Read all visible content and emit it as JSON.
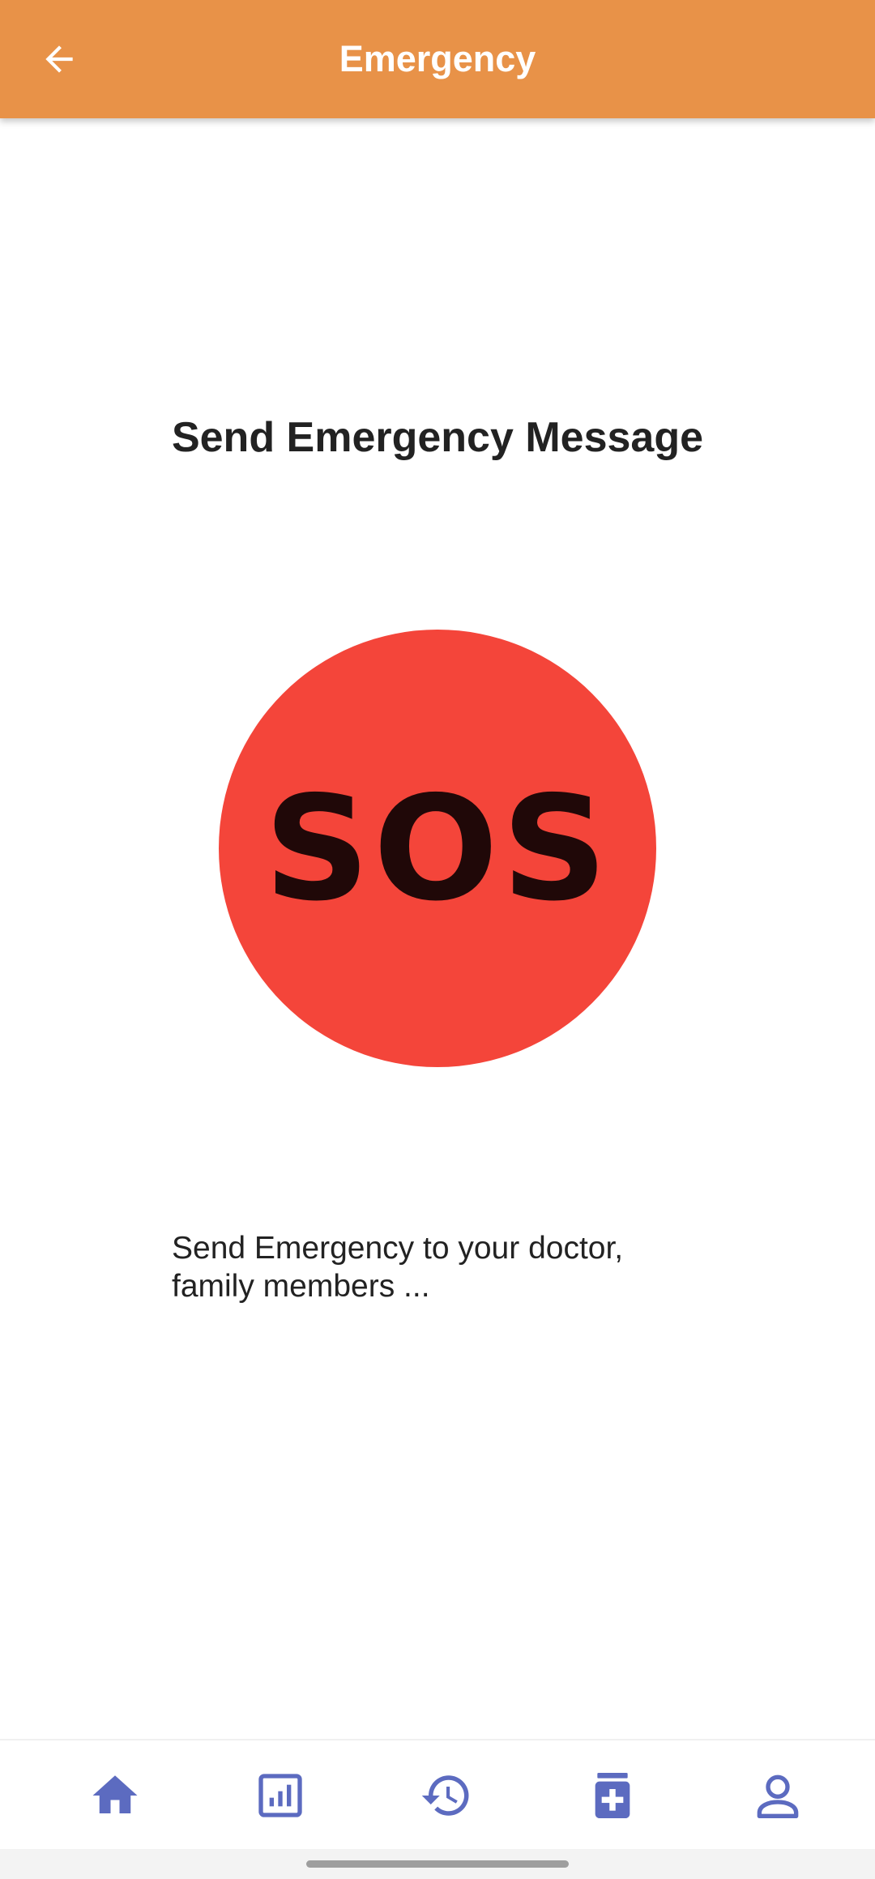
{
  "app_bar": {
    "title": "Emergency",
    "back_icon": "arrow-back-icon",
    "background_color": "#E89248"
  },
  "main": {
    "heading": "Send Emergency Message",
    "sos_button": {
      "label": "SOS",
      "color": "#F4453A",
      "text_color": "#200808"
    },
    "description": "Send Emergency to your doctor, family members ..."
  },
  "bottom_nav": {
    "accent_color": "#5C6BC0",
    "items": [
      {
        "name": "home",
        "icon": "home-icon"
      },
      {
        "name": "reports",
        "icon": "bar-chart-icon"
      },
      {
        "name": "history",
        "icon": "history-icon"
      },
      {
        "name": "medicine",
        "icon": "medicine-icon"
      },
      {
        "name": "profile",
        "icon": "profile-icon"
      }
    ]
  }
}
